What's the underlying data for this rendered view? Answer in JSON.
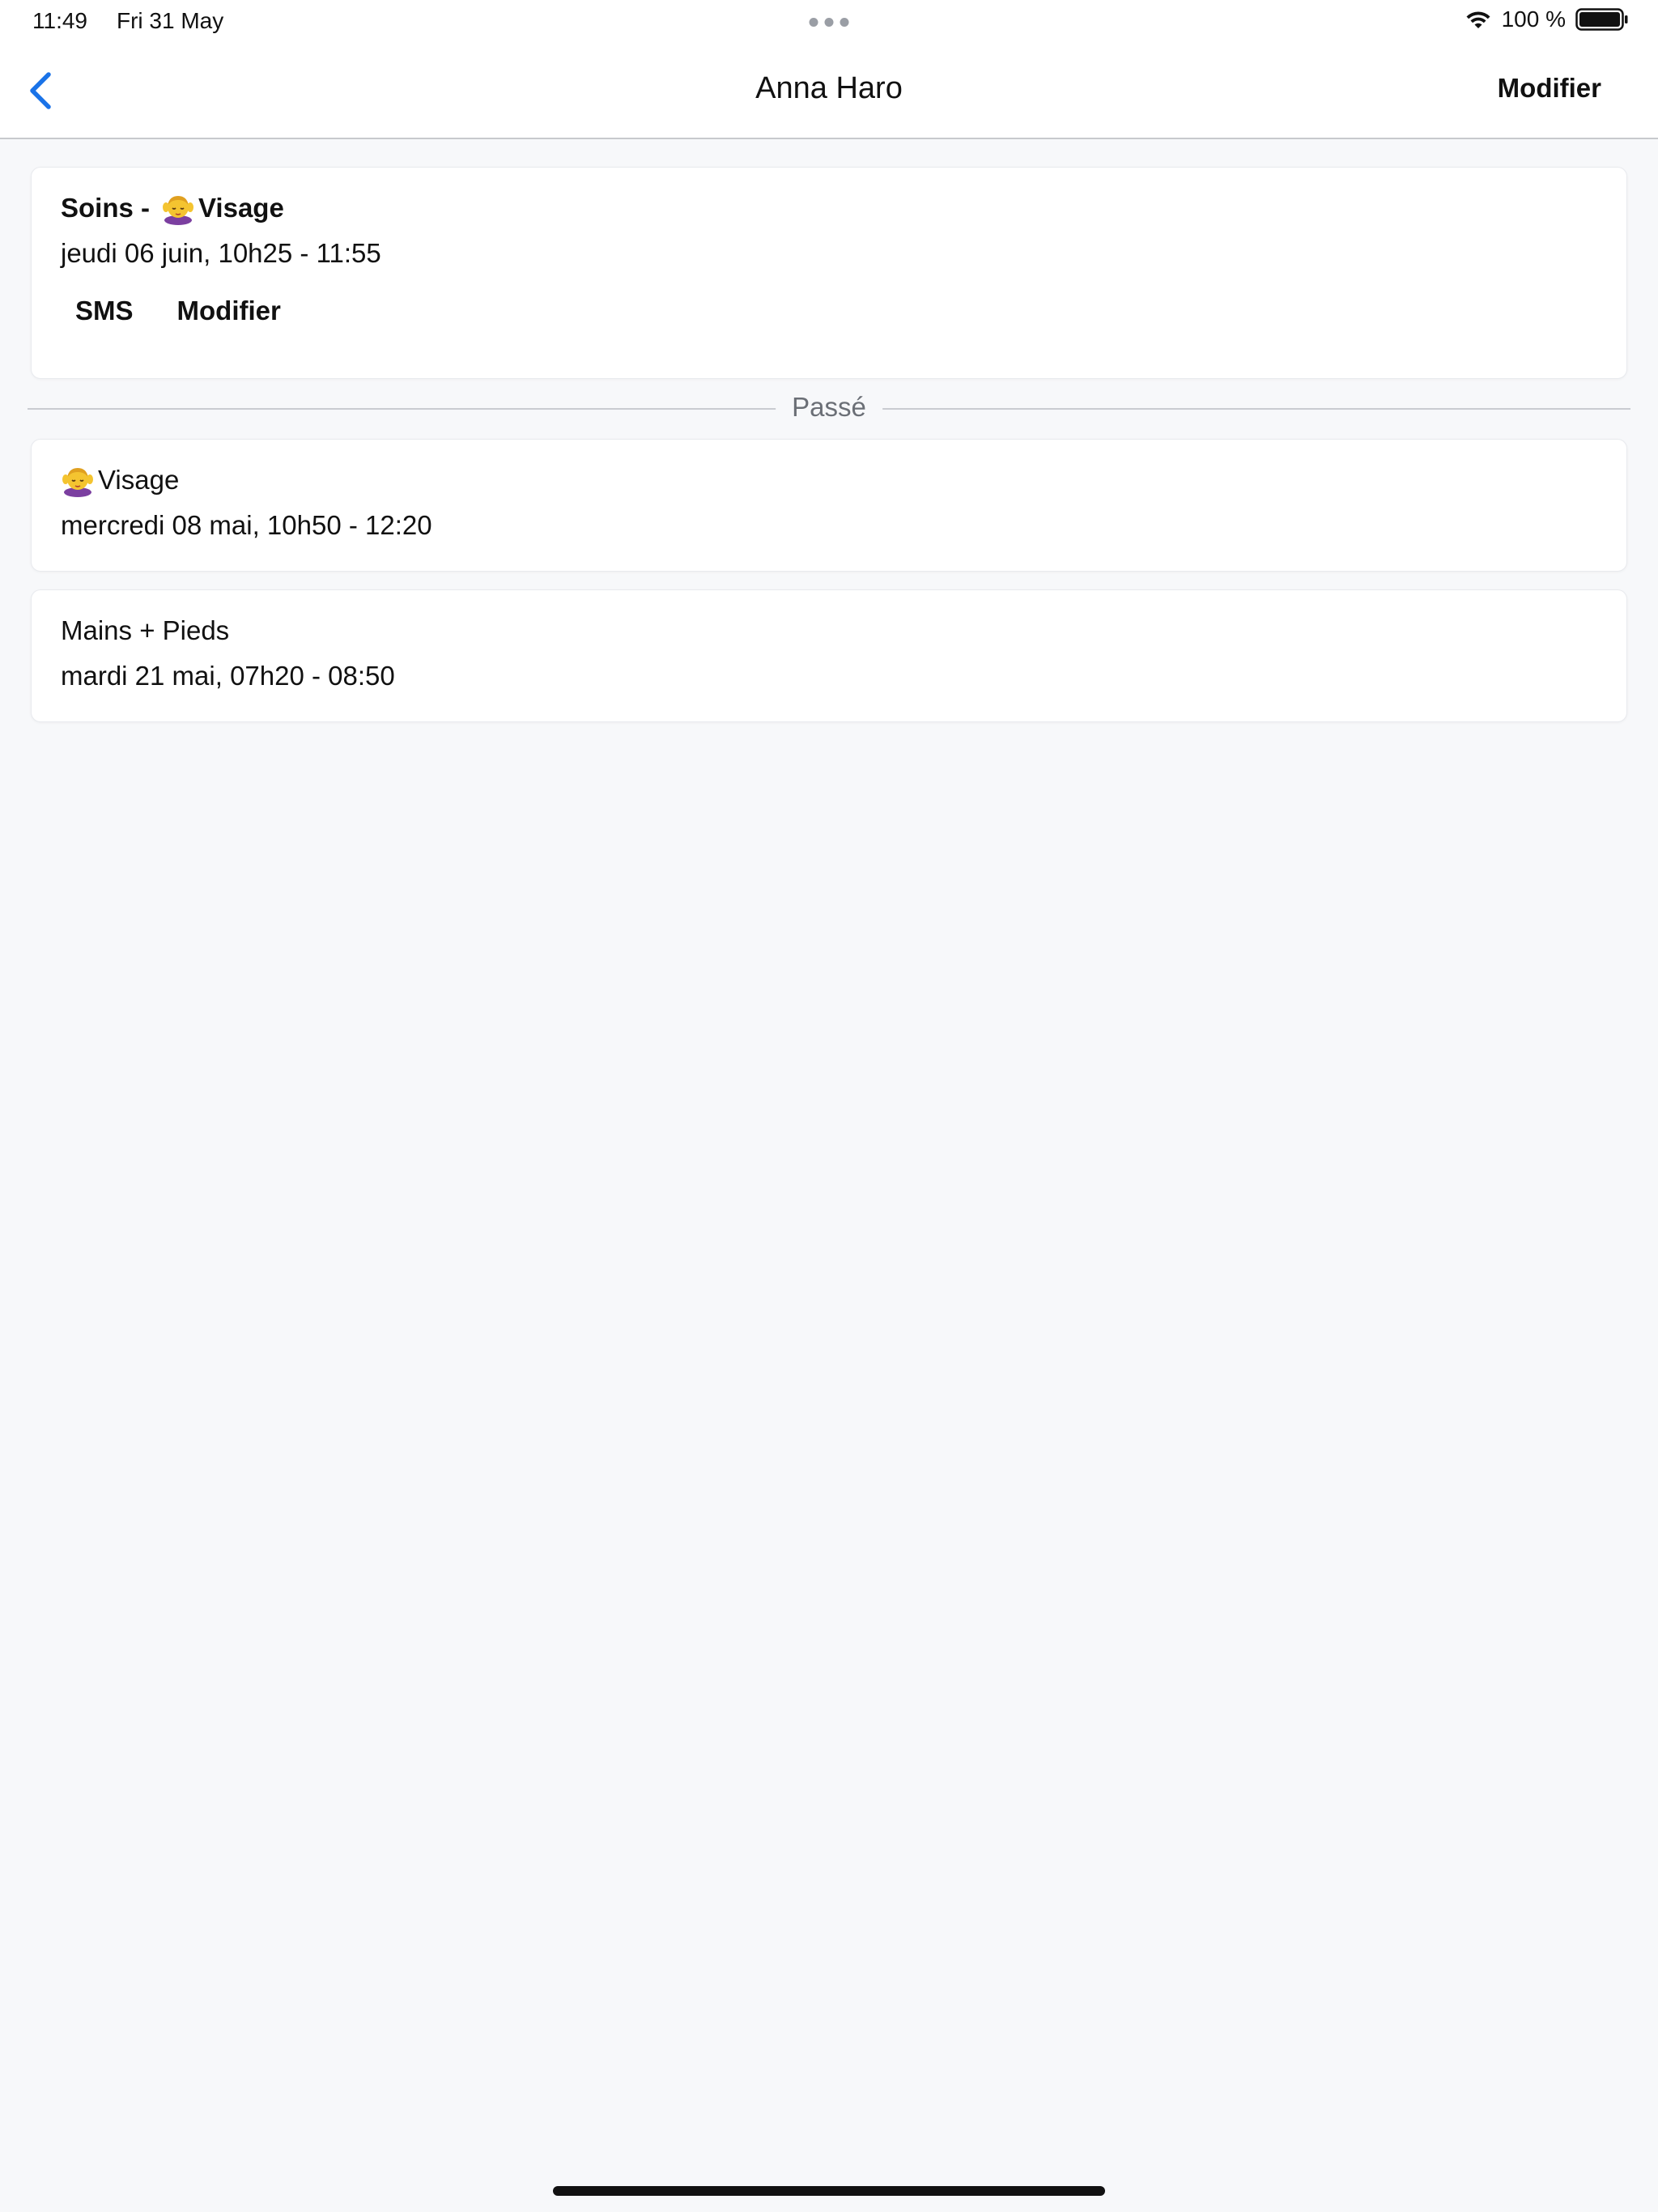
{
  "status_bar": {
    "time": "11:49",
    "date": "Fri 31 May",
    "battery_label": "100 %"
  },
  "nav": {
    "title": "Anna Haro",
    "edit_label": "Modifier",
    "accent_color": "#1a73e8"
  },
  "upcoming": {
    "title_prefix": "Soins -",
    "title_emoji": "woman-getting-face-massage-icon",
    "title_service": "Visage",
    "time": "jeudi 06 juin, 10h25 - 11:55",
    "actions": {
      "sms": "SMS",
      "edit": "Modifier"
    }
  },
  "divider_label": "Passé",
  "past": [
    {
      "emoji": "woman-getting-face-massage-icon",
      "title": "Visage",
      "time": "mercredi 08 mai, 10h50 - 12:20"
    },
    {
      "title": "Mains + Pieds",
      "time": "mardi 21 mai, 07h20 - 08:50"
    }
  ]
}
